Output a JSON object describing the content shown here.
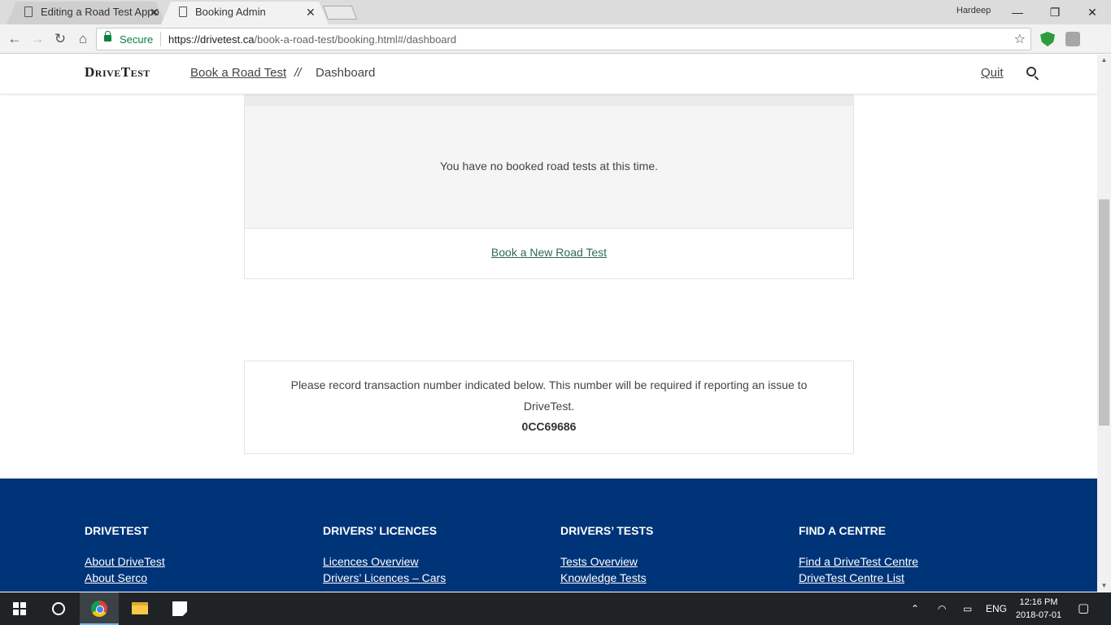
{
  "browser": {
    "tabs": [
      {
        "title": "Editing a Road Test Appo",
        "close": "✕"
      },
      {
        "title": "Booking Admin",
        "close": "✕"
      }
    ],
    "profile_name": "Hardeep",
    "window_controls": {
      "minimize": "—",
      "restore": "❐",
      "close": "✕"
    },
    "security_label": "Secure",
    "url_scheme_host": "https://drivetest.ca",
    "url_path": "/book-a-road-test/booking.html#/dashboard"
  },
  "site": {
    "logo": "DriveTest",
    "breadcrumb_link": "Book a Road Test",
    "breadcrumb_separator": "//",
    "breadcrumb_current": "Dashboard",
    "quit_label": "Quit"
  },
  "main": {
    "empty_message": "You have no booked road tests at this time.",
    "book_new_label": "Book a New Road Test",
    "info_text": "Please record transaction number indicated below. This number will be required if reporting an issue to DriveTest.",
    "transaction_number": "0CC69686"
  },
  "footer": {
    "columns": [
      {
        "heading": "DRIVETEST",
        "links": [
          "About DriveTest",
          "About Serco"
        ]
      },
      {
        "heading": "DRIVERS’ LICENCES",
        "links": [
          "Licences Overview",
          "Drivers’ Licences – Cars"
        ]
      },
      {
        "heading": "DRIVERS’ TESTS",
        "links": [
          "Tests Overview",
          "Knowledge Tests"
        ]
      },
      {
        "heading": "FIND A CENTRE",
        "links": [
          "Find a DriveTest Centre",
          "DriveTest Centre List"
        ]
      }
    ]
  },
  "taskbar": {
    "language": "ENG",
    "time": "12:16 PM",
    "date": "2018-07-01"
  },
  "colors": {
    "footer_bg": "#003478",
    "link_green": "#2e6b55",
    "secure_green": "#0b8043"
  }
}
